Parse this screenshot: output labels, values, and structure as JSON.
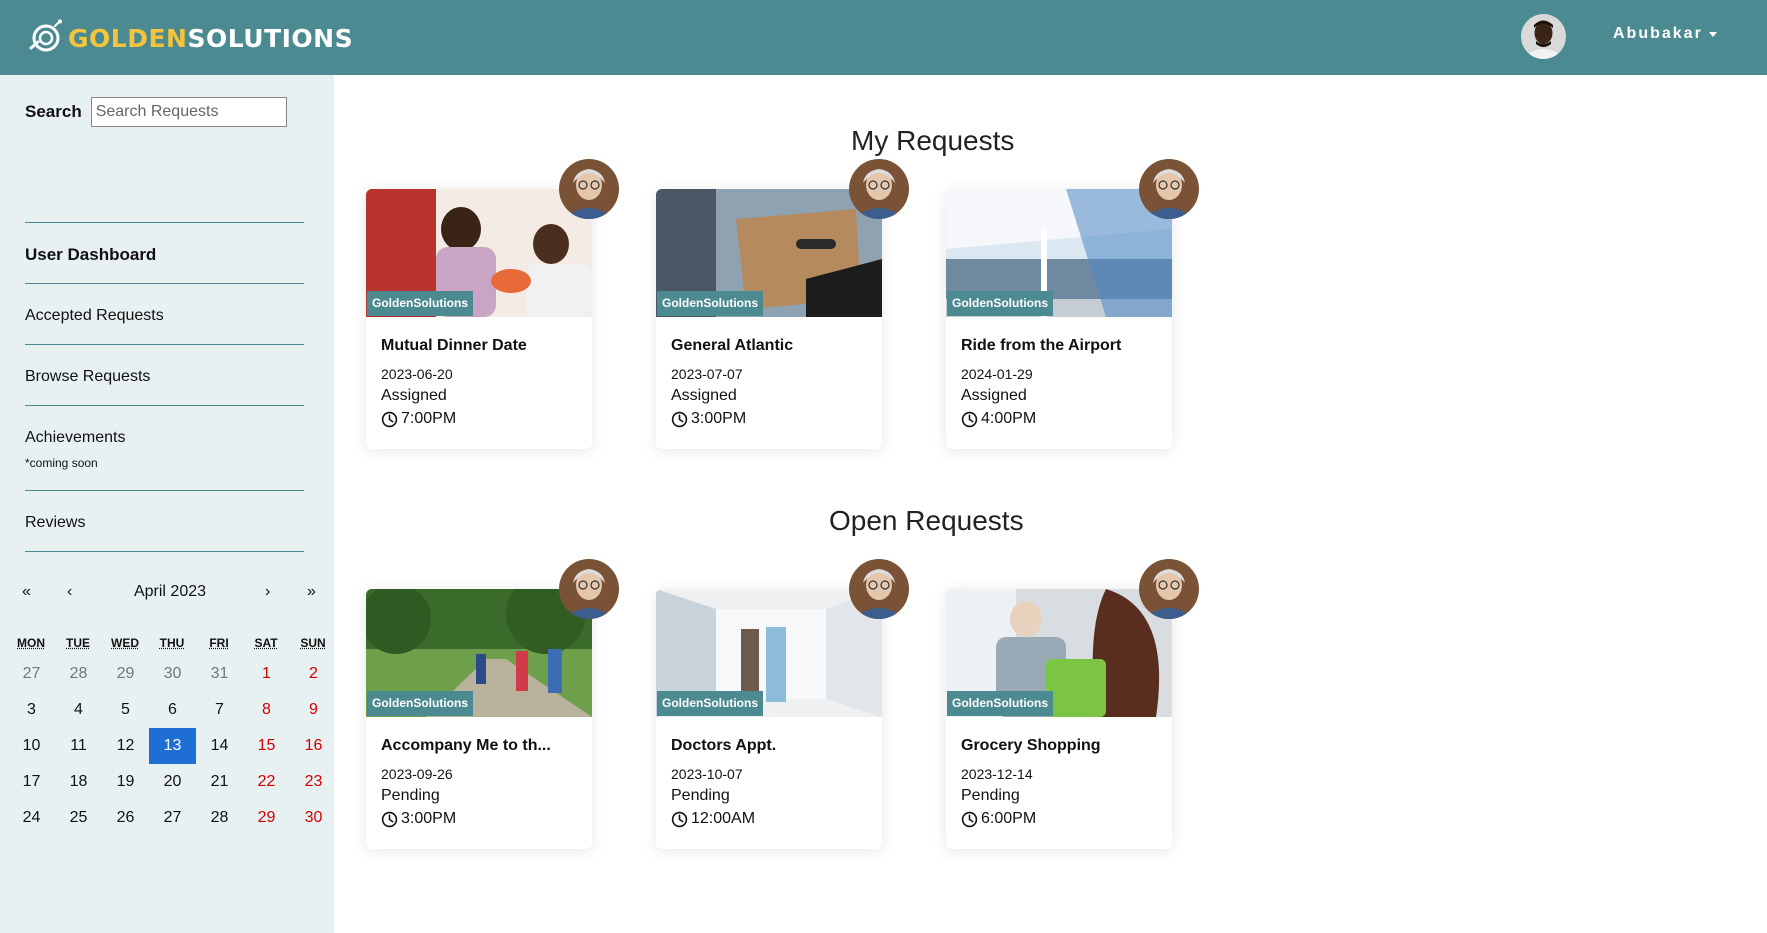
{
  "header": {
    "logo_golden": "GOLDEN",
    "logo_solutions": "SOLUTIONS",
    "username": "Abubakar",
    "bg_color": "#4c8a91",
    "logo_accent": "#f4c43c"
  },
  "sidebar": {
    "search_label": "Search",
    "search_placeholder": "Search Requests",
    "items": [
      {
        "label": "User Dashboard"
      },
      {
        "label": "Accepted Requests"
      },
      {
        "label": "Browse Requests"
      },
      {
        "label": "Achievements",
        "note": "*coming soon"
      },
      {
        "label": "Reviews"
      }
    ]
  },
  "calendar": {
    "month": "April 2023",
    "nav_first": "«",
    "nav_prev": "‹",
    "nav_next": "›",
    "nav_last": "»",
    "weekdays": [
      "MON",
      "TUE",
      "WED",
      "THU",
      "FRI",
      "SAT",
      "SUN"
    ],
    "weeks": [
      [
        "27",
        "28",
        "29",
        "30",
        "31",
        "1",
        "2"
      ],
      [
        "3",
        "4",
        "5",
        "6",
        "7",
        "8",
        "9"
      ],
      [
        "10",
        "11",
        "12",
        "13",
        "14",
        "15",
        "16"
      ],
      [
        "17",
        "18",
        "19",
        "20",
        "21",
        "22",
        "23"
      ],
      [
        "24",
        "25",
        "26",
        "27",
        "28",
        "29",
        "30"
      ]
    ],
    "today": "13",
    "today_color": "#1f6ed4",
    "weekend_color": "#d10000"
  },
  "main": {
    "my_requests_title": "My Requests",
    "open_requests_title": "Open Requests",
    "my_requests": [
      {
        "tag": "GoldenSolutions",
        "title": "Mutual Dinner Date",
        "date": "2023-06-20",
        "status": "Assigned",
        "time": "7:00PM"
      },
      {
        "tag": "GoldenSolutions",
        "title": "General Atlantic",
        "date": "2023-07-07",
        "status": "Assigned",
        "time": "3:00PM"
      },
      {
        "tag": "GoldenSolutions",
        "title": "Ride from the Airport",
        "date": "2024-01-29",
        "status": "Assigned",
        "time": "4:00PM"
      }
    ],
    "open_requests": [
      {
        "tag": "GoldenSolutions",
        "title": "Accompany Me to th...",
        "date": "2023-09-26",
        "status": "Pending",
        "time": "3:00PM"
      },
      {
        "tag": "GoldenSolutions",
        "title": "Doctors Appt.",
        "date": "2023-10-07",
        "status": "Pending",
        "time": "12:00AM"
      },
      {
        "tag": "GoldenSolutions",
        "title": "Grocery Shopping",
        "date": "2023-12-14",
        "status": "Pending",
        "time": "6:00PM"
      }
    ]
  }
}
